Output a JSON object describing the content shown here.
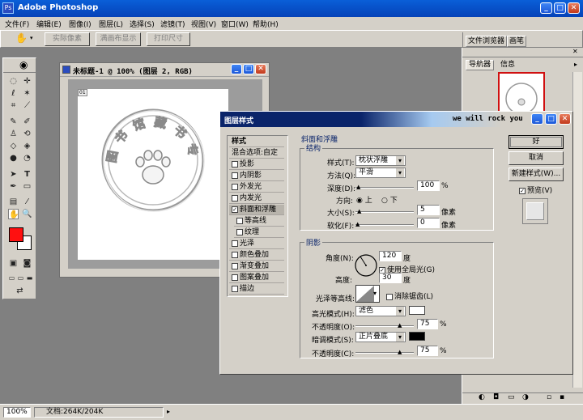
{
  "app": {
    "title": "Adobe Photoshop"
  },
  "menu": [
    "文件(F)",
    "编辑(E)",
    "图像(I)",
    "图层(L)",
    "选择(S)",
    "滤镜(T)",
    "视图(V)",
    "窗口(W)",
    "帮助(H)"
  ],
  "options": {
    "btn1": "实际像素",
    "btn2": "满画布显示",
    "btn3": "打印尺寸"
  },
  "palette_tabs": {
    "file_browser": "文件浏览器",
    "brushes": "画笔"
  },
  "navigator": {
    "tab1": "导航器",
    "tab2": "信息"
  },
  "document": {
    "title": "未标题-1 @ 100% (图层 2, RGB)",
    "stamp_text": "图 书 馆 藏 书 专 用 章"
  },
  "dialog": {
    "title": "图层样式",
    "song": "we will rock you",
    "left_header": "样式",
    "blend_options": "混合选项:自定",
    "items": [
      {
        "label": "投影",
        "checked": false,
        "sub": false
      },
      {
        "label": "内阴影",
        "checked": false,
        "sub": false
      },
      {
        "label": "外发光",
        "checked": false,
        "sub": false
      },
      {
        "label": "内发光",
        "checked": false,
        "sub": false
      },
      {
        "label": "斜面和浮雕",
        "checked": true,
        "sub": false
      },
      {
        "label": "等高线",
        "checked": false,
        "sub": true
      },
      {
        "label": "纹理",
        "checked": false,
        "sub": true
      },
      {
        "label": "光泽",
        "checked": false,
        "sub": false
      },
      {
        "label": "颜色叠加",
        "checked": false,
        "sub": false
      },
      {
        "label": "渐变叠加",
        "checked": false,
        "sub": false
      },
      {
        "label": "图案叠加",
        "checked": false,
        "sub": false
      },
      {
        "label": "描边",
        "checked": false,
        "sub": false
      }
    ],
    "section_title": "斜面和浮雕",
    "structure": {
      "group": "结构",
      "style_label": "样式(T):",
      "style_value": "枕状浮雕",
      "technique_label": "方法(Q):",
      "technique_value": "平滑",
      "depth_label": "深度(D):",
      "depth_value": "100",
      "depth_unit": "%",
      "direction_label": "方向:",
      "dir_up": "上",
      "dir_down": "下",
      "size_label": "大小(S):",
      "size_value": "5",
      "size_unit": "像素",
      "soften_label": "软化(F):",
      "soften_value": "0",
      "soften_unit": "像素"
    },
    "shading": {
      "group": "阴影",
      "angle_label": "角度(N):",
      "angle_value": "120",
      "angle_unit": "度",
      "global_light": "使用全局光(G)",
      "altitude_label": "高度:",
      "altitude_value": "30",
      "altitude_unit": "度",
      "gloss_label": "光泽等高线:",
      "antialias": "消除锯齿(L)",
      "highlight_label": "高光模式(H):",
      "highlight_value": "滤色",
      "highlight_color": "#ffffff",
      "hl_opacity_label": "不透明度(O):",
      "hl_opacity_value": "75",
      "hl_opacity_unit": "%",
      "shadow_label": "暗调模式(S):",
      "shadow_value": "正片叠底",
      "shadow_color": "#000000",
      "sh_opacity_label": "不透明度(C):",
      "sh_opacity_value": "75",
      "sh_opacity_unit": "%"
    },
    "buttons": {
      "ok": "好",
      "cancel": "取消",
      "new_style": "新建样式(W)...",
      "preview": "预览(V)"
    }
  },
  "status": {
    "zoom": "100%",
    "doc": "文档:264K/204K"
  },
  "colors": {
    "foreground": "#ff1010",
    "background": "#ffffff",
    "titlebar": "#0a246a"
  }
}
